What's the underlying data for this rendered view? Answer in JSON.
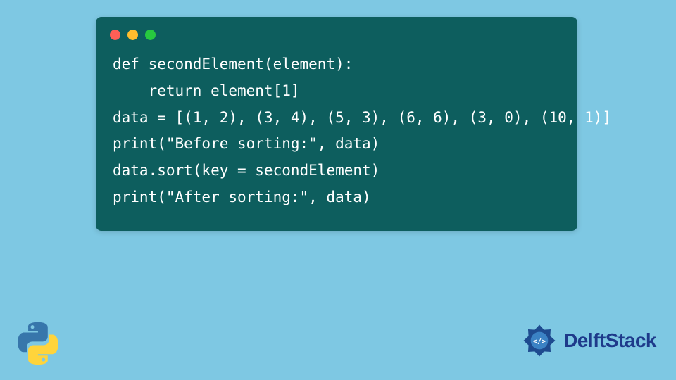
{
  "code": {
    "lines": [
      "def secondElement(element):",
      "    return element[1]",
      "",
      "data = [(1, 2), (3, 4), (5, 3), (6, 6), (3, 0), (10, 1)]",
      "print(\"Before sorting:\", data)",
      "data.sort(key = secondElement)",
      "print(\"After sorting:\", data)"
    ]
  },
  "branding": {
    "site_name": "DelftStack"
  },
  "window": {
    "type": "code-editor"
  }
}
